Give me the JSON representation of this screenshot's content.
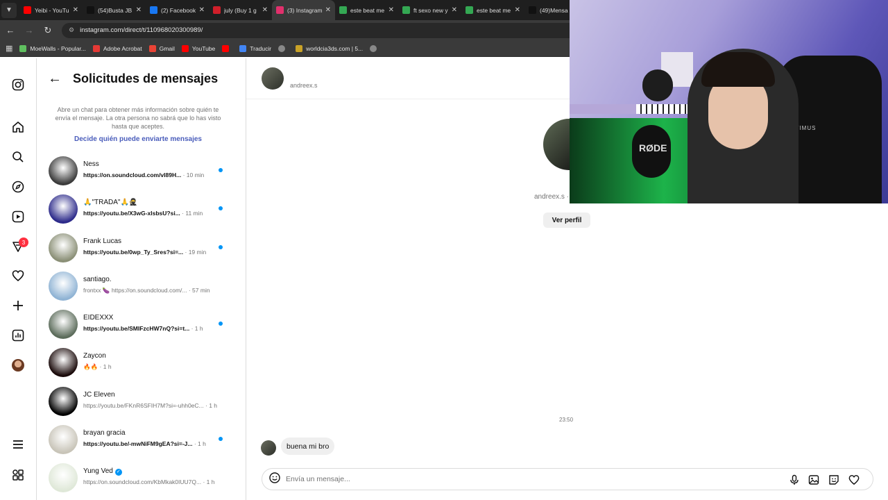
{
  "browser": {
    "tab_menu_icon": "chevron-down-icon",
    "tabs": [
      {
        "title": "Yeibi - YouTu",
        "favicon_color": "#ff0000",
        "active": false
      },
      {
        "title": "(54)Busta JB",
        "favicon_color": "#111111",
        "active": false
      },
      {
        "title": "(2) Facebook",
        "favicon_color": "#1877f2",
        "active": false
      },
      {
        "title": "july (Buy 1 g",
        "favicon_color": "#d01f2a",
        "active": false
      },
      {
        "title": "(3) Instagram",
        "favicon_color": "#e1306c",
        "active": true
      },
      {
        "title": "este beat me",
        "favicon_color": "#34a853",
        "active": false
      },
      {
        "title": "ft sexo new y",
        "favicon_color": "#34a853",
        "active": false
      },
      {
        "title": "este beat me",
        "favicon_color": "#34a853",
        "active": false
      },
      {
        "title": "(49)Mensa",
        "favicon_color": "#111111",
        "active": false
      }
    ],
    "url": "instagram.com/direct/t/110968020300989/",
    "bookmarks": [
      {
        "label": "MoeWalls - Popular...",
        "color": "#5fbf5f"
      },
      {
        "label": "Adobe Acrobat",
        "color": "#e53935"
      },
      {
        "label": "Gmail",
        "color": "#ea4335"
      },
      {
        "label": "YouTube",
        "color": "#ff0000"
      },
      {
        "label": "",
        "color": "#ff0000"
      },
      {
        "label": "Traducir",
        "color": "#4285f4"
      },
      {
        "label": "",
        "color": "#888888"
      },
      {
        "label": "worldcia3ds.com | 5...",
        "color": "#c9a227"
      },
      {
        "label": "",
        "color": "#888888"
      }
    ]
  },
  "rail": {
    "badge_count": "3"
  },
  "requests": {
    "title": "Solicitudes de mensajes",
    "info": "Abre un chat para obtener más información sobre quién te envía el mensaje. La otra persona no sabrá que lo has visto hasta que aceptes.",
    "decide_link": "Decide quién puede enviarte mensajes",
    "items": [
      {
        "name": "Ness",
        "preview": "https://on.soundcloud.com/vI89H...",
        "time": " · 10 min",
        "unread": true,
        "avatar": "#3a3a3a"
      },
      {
        "name": "🙏\"TRADA\"🙏🥷",
        "preview": "https://youtu.be/X3wG-xlsbsU?si...",
        "time": " · 11 min",
        "unread": true,
        "avatar": "#2c2a8a"
      },
      {
        "name": "Frank Lucas",
        "preview": "https://youtu.be/0wp_Ty_Sres?si=...",
        "time": " · 19 min",
        "unread": true,
        "avatar": "#8a8f76"
      },
      {
        "name": "santiago.",
        "preview": "frontxx 🍆 https://on.soundcloud.com/...",
        "time": " · 57 min",
        "unread": false,
        "avatar": "#8fb3d4"
      },
      {
        "name": "EIDEXXX",
        "preview": "https://youtu.be/SMIFzcHW7nQ?si=t...",
        "time": " · 1 h",
        "unread": true,
        "avatar": "#5b6b5a"
      },
      {
        "name": "Zaycon",
        "preview": "🔥🔥",
        "time": " · 1 h",
        "unread": false,
        "avatar": "#1a0a0a"
      },
      {
        "name": "JC Eleven",
        "preview": "https://youtu.be/FKnR6SFIH7M?si=-uhh0eC...",
        "time": " · 1 h",
        "unread": false,
        "avatar": "#000000"
      },
      {
        "name": "brayan gracia",
        "preview": "https://youtu.be/-mwNiFM9gEA?si=-J...",
        "time": " · 1 h",
        "unread": true,
        "avatar": "#c8c4b8"
      },
      {
        "name": "Yung Ved",
        "preview": "https://on.soundcloud.com/KbMkak0IUU7Q...",
        "time": " · 1 h",
        "unread": false,
        "verified": true,
        "avatar": "#dfe8d8"
      }
    ]
  },
  "chat": {
    "username": "andreex.s",
    "profile_name": "andreex.s ·",
    "view_profile": "Ver perfil",
    "timestamp": "23:50",
    "message": "buena mi bro",
    "composer_placeholder": "Envía un mensaje..."
  },
  "webcam": {
    "mic_label": "RØDE",
    "chair_label": "OPTIMUS"
  }
}
